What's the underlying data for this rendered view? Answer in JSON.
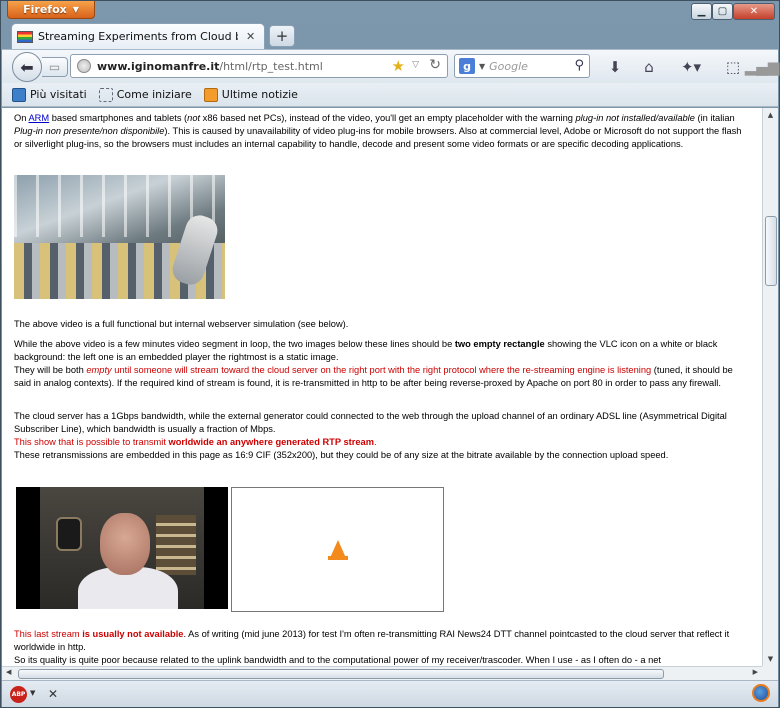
{
  "browser": {
    "app_button": "Firefox",
    "tab_title": "Streaming Experiments from Cloud by Igi...",
    "url_host": "www.iginomanfre.it",
    "url_path": "/html/rtp_test.html",
    "search_placeholder": "Google",
    "bookmarks": [
      "Più visitati",
      "Come iniziare",
      "Ultime notizie"
    ],
    "abp_label": "ABP"
  },
  "content": {
    "p1": {
      "t1": "On ",
      "arm": "ARM",
      "t2": " based smartphones and tablets (",
      "t3": "not",
      "t4": " x86 based net PCs), instead of the video, you'll get an empty placeholder with the warning ",
      "t5": "plug-in not installed/available",
      "t6": " (in italian ",
      "t7": "Plug-in non presente/non disponibile",
      "t8": "). This is caused by unavailability of video plug-ins for mobile browsers. Also at commercial level, Adobe or Microsoft do not support the flash or silverlight plug-ins, so the browsers must includes an internal capability to handle, decode and present some video formats or are specific decoding applications."
    },
    "p2": "The above video is a full functional but internal webserver simulation (see below).",
    "p3": {
      "t1": "While the above video is a few minutes video segment in loop, the two images below these lines should be ",
      "t2": "two empty rectangle",
      "t3": " showing the VLC icon on a white or black background: the left one is an embedded player the rightmost is a static image.",
      "t4": "They will be both ",
      "t5": "empty",
      "t6": " until someone will stream toward the cloud server on the right port with the right protocol where the re-streaming engine is listening",
      "t7": " (tuned, it should be said in analog contexts). If the required kind of stream is found, it is re-transmitted in http to be after being reverse-proxed by Apache on port 80 in order to pass any firewall."
    },
    "p4": {
      "t1": "The cloud server has a 1Gbps bandwidth, while the external generator could connected to the web through the upload channel of an ordinary ADSL line (Asymmetrical Digital Subscriber Line), which bandwidth is usually a fraction of Mbps.",
      "t2": "This show that is possible to transmit ",
      "t3": "worldwide an anywhere generated RTP stream",
      "t4": ".",
      "t5": "These retransmissions are embedded in this page as 16:9 CIF (352x200), but they could be of any size at the bitrate available by the connection upload speed."
    },
    "p5": {
      "t1": "This last stream ",
      "t2": "is usually not available",
      "t3": ". As of writing (mid june 2013) for test I'm often re-transmitting RAI News24 DTT channel pointcasted to the cloud server that reflect it worldwide in http.",
      "t4": "So its quality is quite poor because related to the uplink bandwidth and to the computational power of my receiver/trascoder. When I use - as I often do - a net"
    }
  }
}
